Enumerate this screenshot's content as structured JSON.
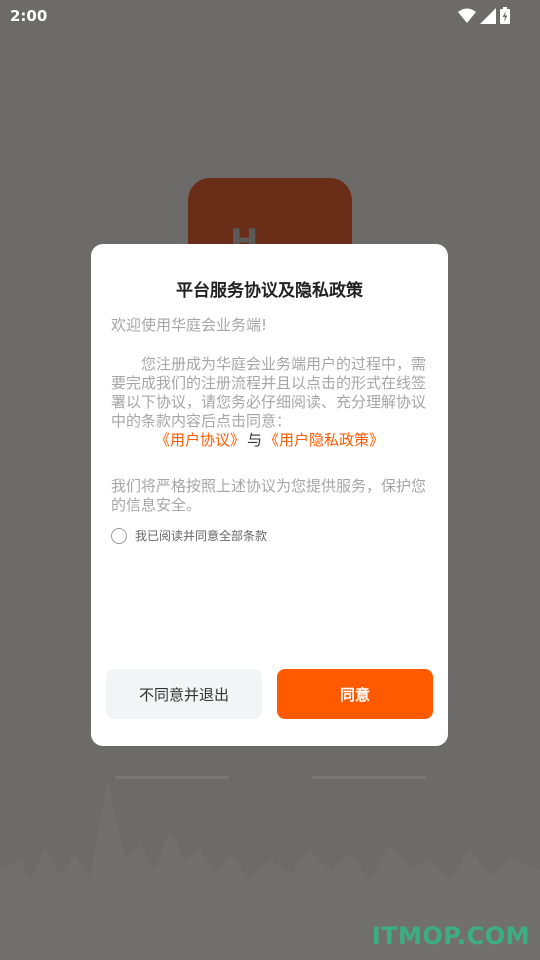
{
  "status_bar": {
    "time": "2:00"
  },
  "background": {
    "logo_glyph": "H",
    "watermark": "ITMOP.COM"
  },
  "dialog": {
    "title": "平台服务协议及隐私政策",
    "intro": "欢迎使用华庭会业务端!",
    "paragraph": "您注册成为华庭会业务端用户的过程中，需要完成我们的注册流程并且以点击的形式在线签署以下协议，请您务必仔细阅读、充分理解协议中的条款内容后点击同意：",
    "link_user_agreement": "《用户协议》",
    "links_separator": "与",
    "link_privacy_policy": "《用户隐私政策》",
    "paragraph2": "我们将严格按照上述协议为您提供服务，保护您的信息安全。",
    "checkbox_label": "我已阅读并同意全部条款",
    "checkbox_checked": false,
    "decline_button": "不同意并退出",
    "agree_button": "同意"
  },
  "colors": {
    "accent": "#ff5a00",
    "overlay": "#6d6b6a"
  }
}
